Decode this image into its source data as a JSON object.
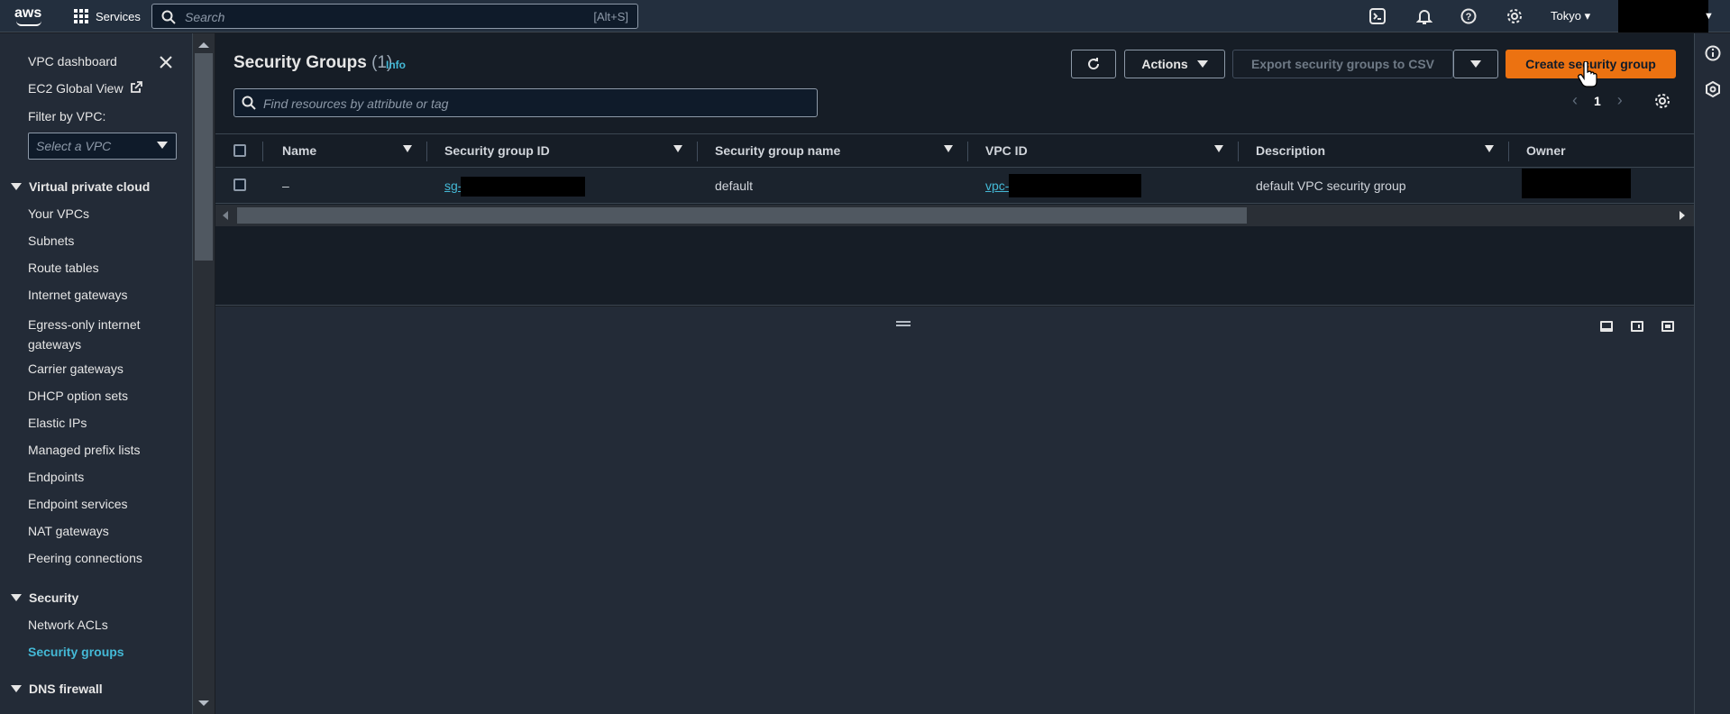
{
  "topbar": {
    "logo": "aws",
    "services_label": "Services",
    "search_placeholder": "Search",
    "search_shortcut": "[Alt+S]",
    "region": "Tokyo",
    "icons": [
      "cloudshell-icon",
      "notifications-icon",
      "help-icon",
      "settings-icon"
    ]
  },
  "sidebar": {
    "top_links": [
      "VPC dashboard",
      "EC2 Global View"
    ],
    "filter_label": "Filter by VPC:",
    "filter_placeholder": "Select a VPC",
    "sections": [
      {
        "title": "Virtual private cloud",
        "items": [
          "Your VPCs",
          "Subnets",
          "Route tables",
          "Internet gateways",
          "Egress-only internet gateways",
          "Carrier gateways",
          "DHCP option sets",
          "Elastic IPs",
          "Managed prefix lists",
          "Endpoints",
          "Endpoint services",
          "NAT gateways",
          "Peering connections"
        ]
      },
      {
        "title": "Security",
        "items": [
          "Network ACLs",
          "Security groups"
        ],
        "active": "Security groups"
      },
      {
        "title": "DNS firewall",
        "items": []
      }
    ]
  },
  "main": {
    "title": "Security Groups",
    "count": "(1)",
    "info": "Info",
    "buttons": {
      "refresh": "refresh-icon",
      "actions": "Actions",
      "export": "Export security groups to CSV",
      "create": "Create security group"
    },
    "filter_placeholder": "Find resources by attribute or tag",
    "page": "1",
    "columns": [
      "Name",
      "Security group ID",
      "Security group name",
      "VPC ID",
      "Description",
      "Owner"
    ],
    "rows": [
      {
        "name": "–",
        "sg_id": "sg-",
        "sg_name": "default",
        "vpc_id": "vpc-",
        "description": "default VPC security group",
        "owner": ""
      }
    ]
  },
  "colors": {
    "accent": "#ec7211",
    "link": "#44b9d6",
    "topbar": "#232f3e",
    "background": "#161d26"
  }
}
